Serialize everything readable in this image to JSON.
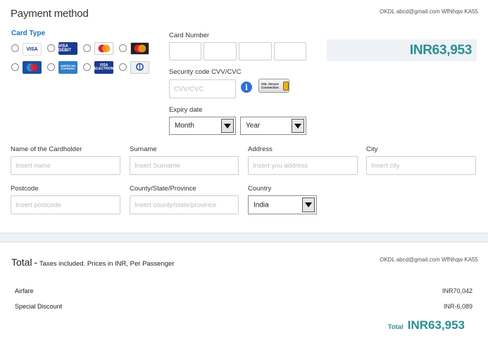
{
  "payment": {
    "title": "Payment method",
    "reference": "OKDL abcd@gmail.com WfNhqw KA55",
    "card_type_label": "Card Type",
    "card_logos": [
      "VISA",
      "VISA DEBIT",
      "Maestro",
      "MasterCard",
      "Maestro",
      "AMERICAN EXPRESS",
      "VISA ELECTRON",
      "Diners Club"
    ],
    "card_number_label": "Card Number",
    "amount": "INR63,953",
    "cvv_label": "Security code CVV/CVC",
    "cvv_placeholder": "CVV/CVC",
    "ssl_text": "SSL Secure Connection",
    "expiry_label": "Expiry date",
    "month_value": "Month",
    "year_value": "Year"
  },
  "fields": {
    "cardholder_label": "Name of the Cardholder",
    "cardholder_placeholder": "Insert name",
    "surname_label": "Surname",
    "surname_placeholder": "Insert Surname",
    "address_label": "Address",
    "address_placeholder": "Insert you address",
    "city_label": "City",
    "city_placeholder": "Insert city",
    "postcode_label": "Postcode",
    "postcode_placeholder": "Insert postcode",
    "county_label": "County/State/Province",
    "county_placeholder": "Insert county/state/province",
    "country_label": "Country",
    "country_value": "India"
  },
  "summary": {
    "title": "Total",
    "dash": "-",
    "subtitle": "Taxes included. Prices in INR, Per Passenger",
    "reference": "OKDL abcd@gmail.com WfNhqw KA55",
    "rows": [
      {
        "label": "Airfare",
        "value": "INR70,042"
      },
      {
        "label": "Special Discount",
        "value": "INR-6,089"
      }
    ],
    "total_word": "Total",
    "total_amount": "INR63,953"
  },
  "colors": {
    "accent_teal": "#2a8f92",
    "card_type_blue": "#1a73c9",
    "info_blue": "#2f6ed6"
  }
}
